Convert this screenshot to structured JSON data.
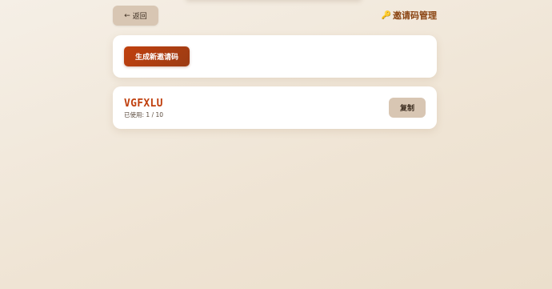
{
  "header": {
    "back_label": "返回",
    "back_icon": "←",
    "title": "邀请码管理",
    "title_icon": "🔑"
  },
  "generate": {
    "button_label": "生成新邀请码"
  },
  "codes": [
    {
      "code": "VGFXLU",
      "usage": "已使用: 1 / 10",
      "copy_label": "复制"
    }
  ],
  "colors": {
    "accent": "#c0400e",
    "title": "#8b4513",
    "secondary_button": "#d8c6b3"
  }
}
